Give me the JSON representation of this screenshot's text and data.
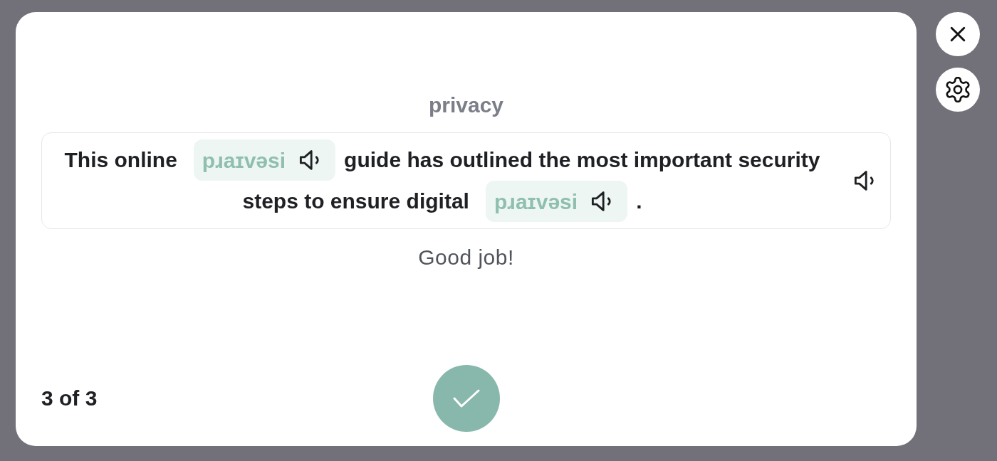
{
  "prompt": {
    "word": "privacy"
  },
  "sentence": {
    "lines": [
      [
        {
          "kind": "text",
          "text": "This online"
        },
        {
          "kind": "answer",
          "text": "pɹaɪvəsi"
        },
        {
          "kind": "text",
          "text": "guide has outlined the most important security"
        }
      ],
      [
        {
          "kind": "text",
          "text": "steps to ensure digital"
        },
        {
          "kind": "answer",
          "text": "pɹaɪvəsi"
        },
        {
          "kind": "text",
          "text": "."
        }
      ]
    ]
  },
  "feedback": "Good job!",
  "progress": "3 of 3"
}
